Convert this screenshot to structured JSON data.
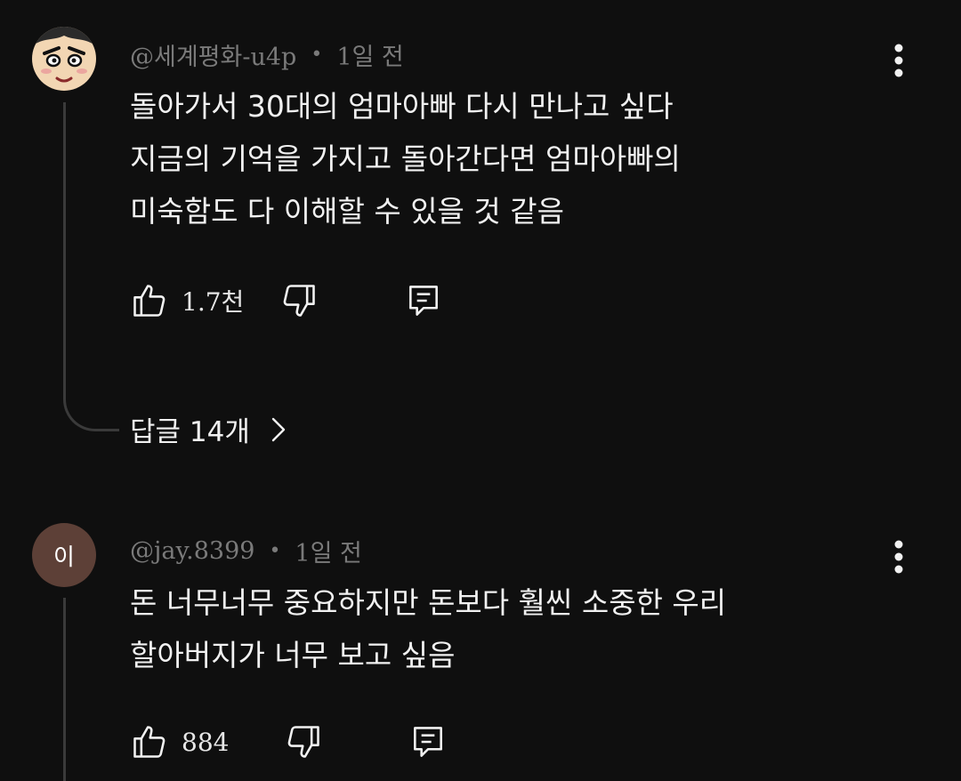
{
  "comments": [
    {
      "author": "@세계평화-u4p",
      "separator": "•",
      "time": "1일 전",
      "avatar_icon": "cartoon-face-avatar",
      "lines": [
        "돌아가서 30대의 엄마아빠 다시 만나고 싶다",
        "지금의 기억을 가지고 돌아간다면 엄마아빠의",
        "미숙함도 다 이해할 수 있을 것 같음"
      ],
      "likes": "1.7천",
      "replies_label": "답글 14개",
      "replies_chevron": "›"
    },
    {
      "author": "@jay.8399",
      "separator": "•",
      "time": "1일 전",
      "avatar_letter": "이",
      "avatar_color": "#5d4037",
      "lines": [
        "돈 너무너무 중요하지만 돈보다 훨씬 소중한 우리",
        "할아버지가 너무 보고 싶음"
      ],
      "likes": "884"
    }
  ],
  "icons": {
    "like": "thumbs-up-icon",
    "dislike": "thumbs-down-icon",
    "reply": "reply-comment-icon",
    "more": "more-vert-icon"
  },
  "colors": {
    "background": "#0f0f0f",
    "text": "#f1f1f1",
    "meta": "#7a7a7a",
    "thread": "#3a3a3a"
  }
}
